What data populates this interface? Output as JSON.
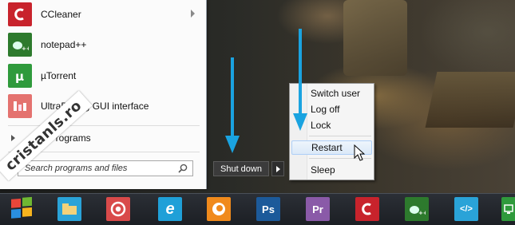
{
  "start_menu": {
    "programs": [
      {
        "label": "CCleaner",
        "icon": "ccleaner-icon",
        "color": "#c8232c",
        "has_submenu": true
      },
      {
        "label": "notepad++",
        "icon": "notepadpp-icon",
        "color": "#2d7a2d",
        "has_submenu": false
      },
      {
        "label": "µTorrent",
        "icon": "utorrent-icon",
        "color": "#2f9a3c",
        "has_submenu": false
      },
      {
        "label": "UltraDefrag GUI interface",
        "icon": "ultradefrag-icon",
        "color": "#e4726f",
        "has_submenu": false
      }
    ],
    "all_programs": "All Programs",
    "search_placeholder": "Search programs and files"
  },
  "shutdown": {
    "label": "Shut down"
  },
  "context_menu": {
    "items": [
      "Switch user",
      "Log off",
      "Lock",
      "Restart",
      "Sleep"
    ],
    "highlighted": "Restart"
  },
  "taskbar": {
    "items": [
      {
        "name": "explorer-icon",
        "color": "#2aa3d8"
      },
      {
        "name": "chrome-icon",
        "color": "#d94a4a"
      },
      {
        "name": "internet-explorer-icon",
        "color": "#1fa0d8",
        "glyph": "e"
      },
      {
        "name": "firefox-icon",
        "color": "#f08a1c"
      },
      {
        "name": "photoshop-icon",
        "color": "#1c5a9a",
        "glyph": "Ps"
      },
      {
        "name": "premiere-icon",
        "color": "#8a5aa8",
        "glyph": "Pr"
      },
      {
        "name": "ccleaner-icon",
        "color": "#c8232c"
      },
      {
        "name": "notepadpp-icon",
        "color": "#2d7a2d"
      },
      {
        "name": "code-editor-icon",
        "color": "#2aa3d8",
        "glyph": "</>"
      },
      {
        "name": "green-app-icon",
        "color": "#2f9a3c"
      }
    ]
  },
  "watermark": "cristanls.ro",
  "colors": {
    "arrow_blue": "#1aa3e0",
    "menu_highlight": "#dbe9f8"
  }
}
